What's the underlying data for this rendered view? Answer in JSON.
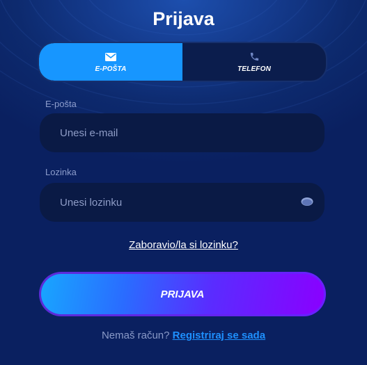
{
  "header": {
    "title": "Prijava"
  },
  "tabs": [
    {
      "label": "E-POŠTA",
      "icon": "envelope-icon",
      "active": true
    },
    {
      "label": "TELEFON",
      "icon": "phone-icon",
      "active": false
    }
  ],
  "email": {
    "label": "E-pošta",
    "placeholder": "Unesi e-mail",
    "value": ""
  },
  "password": {
    "label": "Lozinka",
    "placeholder": "Unesi lozinku",
    "value": "",
    "toggle_icon": "eye-icon"
  },
  "forgot_link": "Zaboravio/la si lozinku?",
  "login_button": "PRIJAVA",
  "register": {
    "prompt": "Nemaš račun?",
    "link": "Registriraj se sada"
  },
  "colors": {
    "background": "#0d2a6e",
    "active_tab": "#1796ff",
    "field_bg": "#0a1a45",
    "link": "#1e90ff",
    "button_gradient_start": "#18a6ff",
    "button_gradient_end": "#8a00ff"
  }
}
